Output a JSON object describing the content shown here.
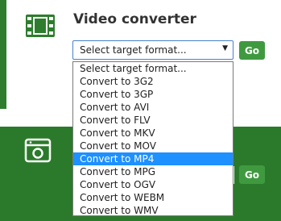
{
  "video_converter": {
    "title": "Video converter",
    "icon": "film-strip-icon",
    "select": {
      "value": "Select target format...",
      "arrow": "▼"
    },
    "go_label": "Go",
    "options": [
      "Select target format...",
      "Convert to 3G2",
      "Convert to 3GP",
      "Convert to AVI",
      "Convert to FLV",
      "Convert to MKV",
      "Convert to MOV",
      "Convert to MP4",
      "Convert to MPG",
      "Convert to OGV",
      "Convert to WEBM",
      "Convert to WMV"
    ],
    "highlighted_option": "Convert to MP4"
  },
  "second_converter": {
    "icon": "camera-window-icon",
    "go_label": "Go"
  },
  "colors": {
    "accent_green": "#2e7d2e",
    "button_green": "#3f9a3f",
    "highlight_blue": "#1e90ff",
    "select_border": "#4a80c8"
  }
}
